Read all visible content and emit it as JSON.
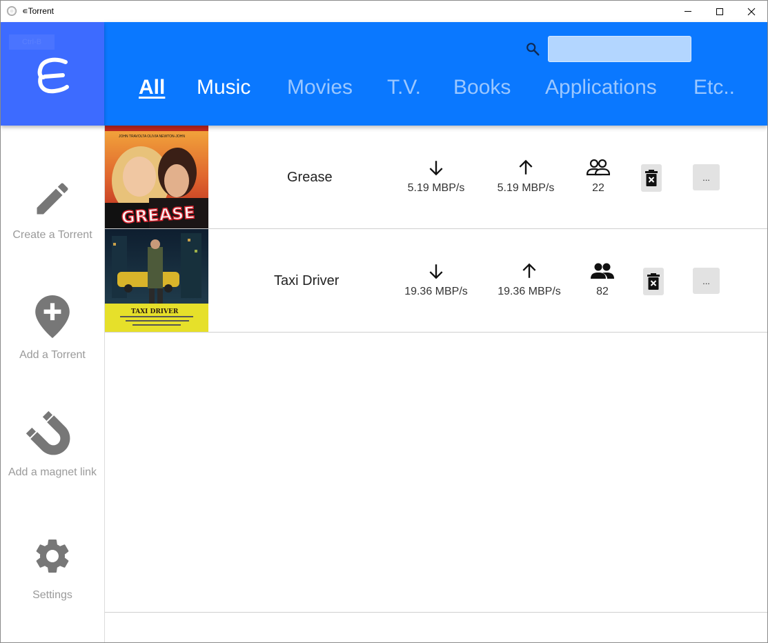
{
  "window": {
    "title": "∊Torrent"
  },
  "logo": {
    "ghost_label": "Ctrl-B"
  },
  "search": {
    "value": "",
    "placeholder": ""
  },
  "tabs": [
    {
      "label": "All",
      "active": true
    },
    {
      "label": "Music",
      "active": false
    },
    {
      "label": "Movies",
      "active": false
    },
    {
      "label": "T.V.",
      "active": false
    },
    {
      "label": "Books",
      "active": false
    },
    {
      "label": "Applications",
      "active": false
    },
    {
      "label": "Etc..",
      "active": false
    }
  ],
  "sidebar": {
    "items": [
      {
        "label": "Create a Torrent",
        "icon": "pencil-icon"
      },
      {
        "label": "Add a Torrent",
        "icon": "map-pin-plus-icon"
      },
      {
        "label": "Add a magnet link",
        "icon": "magnet-icon"
      },
      {
        "label": "Settings",
        "icon": "gear-icon"
      }
    ]
  },
  "torrents": [
    {
      "title": "Grease",
      "download_speed": "5.19 MBP/s",
      "upload_speed": "5.19 MBP/s",
      "peers": "22",
      "more_label": "...",
      "poster": {
        "top_names": "JOHN TRAVOLTA   OLIVIA NEWTON-JOHN",
        "logo_text": "GREASE"
      }
    },
    {
      "title": "Taxi Driver",
      "download_speed": "19.36 MBP/s",
      "upload_speed": "19.36 MBP/s",
      "peers": "82",
      "more_label": "...",
      "poster": {
        "bottom_text": "TAXI DRIVER"
      }
    }
  ],
  "colors": {
    "header_blue": "#0a78ff",
    "logo_blue": "#3d6bff",
    "sidebar_icon_gray": "#777777",
    "sidebar_text_gray": "#9a9a9a"
  }
}
